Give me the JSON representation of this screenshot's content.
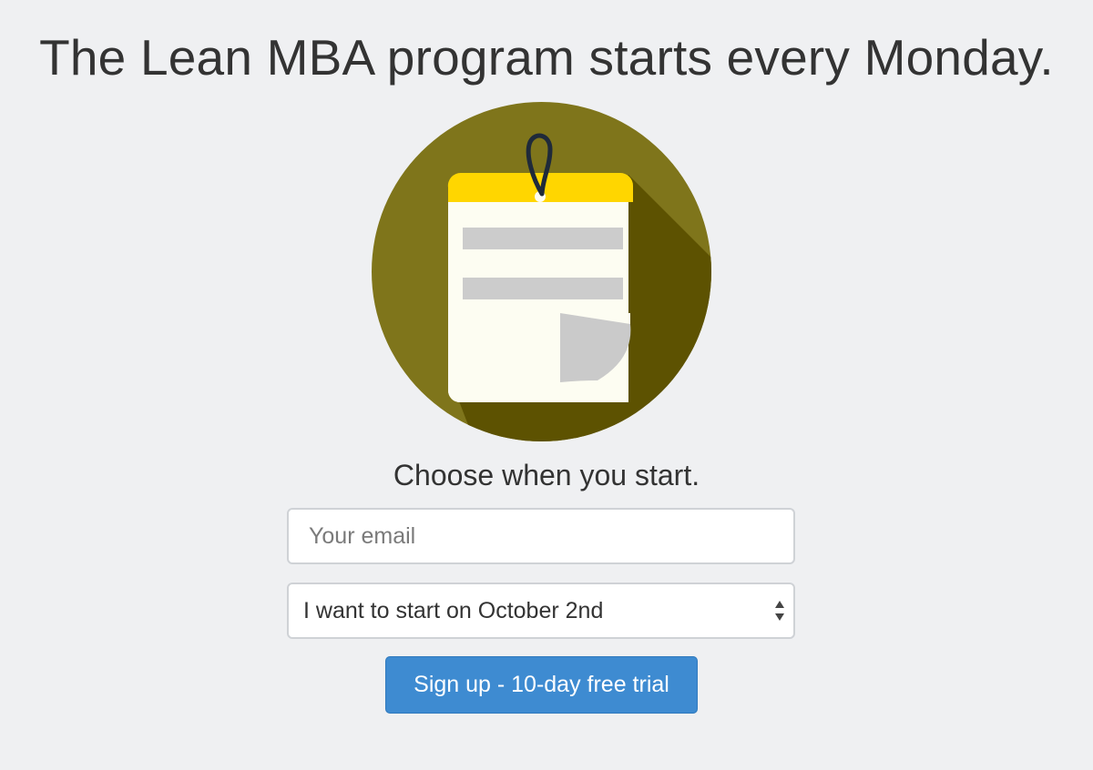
{
  "headline": "The Lean MBA program starts every Monday.",
  "illustration": {
    "icon": "notepad-icon",
    "circle_color": "#7f751b",
    "shadow_color": "#5d5201",
    "tab_color": "#ffd600",
    "paper_color": "#fdfdf2",
    "line_color": "#cccccc",
    "string_color": "#1f2a3a"
  },
  "subheading": "Choose when you start.",
  "email": {
    "placeholder": "Your email",
    "value": ""
  },
  "start_date": {
    "selected": "I want to start on October 2nd"
  },
  "signup": {
    "label": "Sign up - 10-day free trial",
    "color": "#3e8bd1"
  }
}
